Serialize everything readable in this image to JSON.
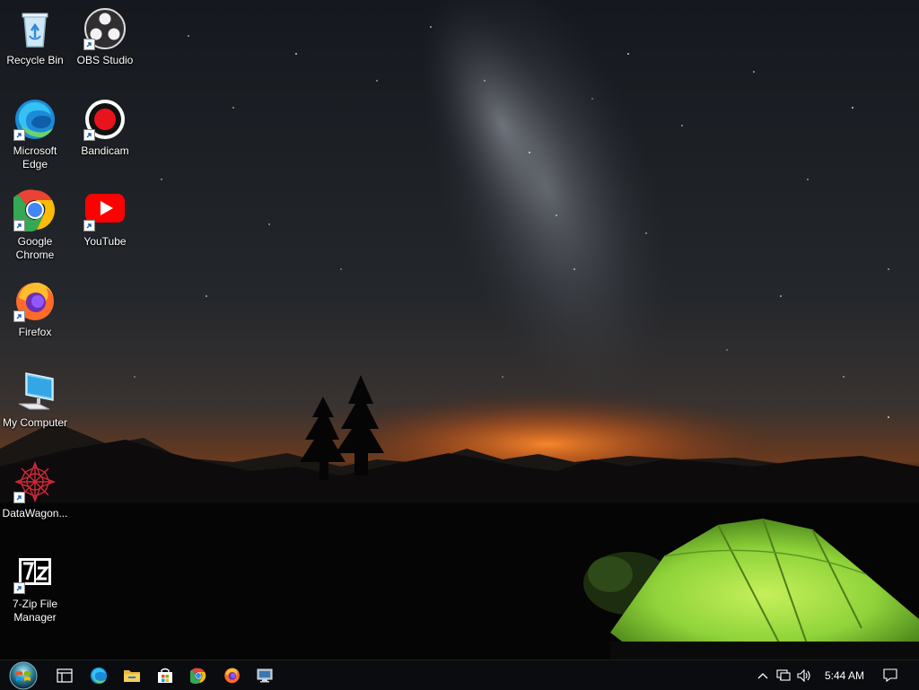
{
  "desktop": {
    "icons": [
      {
        "label": "Recycle Bin",
        "icon": "recycle-bin-icon"
      },
      {
        "label": "OBS Studio",
        "icon": "obs-studio-icon"
      },
      {
        "label": "Microsoft Edge",
        "icon": "edge-icon"
      },
      {
        "label": "Bandicam",
        "icon": "bandicam-icon"
      },
      {
        "label": "Google Chrome",
        "icon": "chrome-icon"
      },
      {
        "label": "YouTube",
        "icon": "youtube-icon"
      },
      {
        "label": "Firefox",
        "icon": "firefox-icon"
      },
      {
        "label": "My Computer",
        "icon": "computer-icon"
      },
      {
        "label": "DataWagon...",
        "icon": "datawagon-icon"
      },
      {
        "label": "7-Zip File Manager",
        "icon": "7zip-icon"
      }
    ]
  },
  "taskbar": {
    "pinned": [
      "start-icon",
      "task-view-icon",
      "edge-icon",
      "file-explorer-icon",
      "store-icon",
      "chrome-icon",
      "firefox-icon",
      "remote-desktop-icon"
    ],
    "tray": {
      "clock": "5:44 AM",
      "icons": [
        "chevron-up-icon",
        "network-icon",
        "volume-icon",
        "notification-icon"
      ]
    }
  },
  "colors": {
    "taskbar_bg": "#0b0c0f",
    "tent_green": "#8fd33a",
    "horizon_glow": "#e2691c"
  }
}
